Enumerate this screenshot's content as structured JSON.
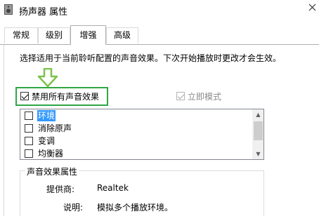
{
  "window": {
    "title": "扬声器 属性",
    "close_glyph": "X"
  },
  "tabs": [
    {
      "label": "常规",
      "active": false
    },
    {
      "label": "级别",
      "active": false
    },
    {
      "label": "增强",
      "active": true
    },
    {
      "label": "高级",
      "active": false
    }
  ],
  "enhancements": {
    "description": "选择适用于当前聆听配置的声音效果。下次开始播放时更改才会生效。",
    "disable_all": {
      "label": "禁用所有声音效果",
      "checked": true
    },
    "immediate_mode": {
      "label": "立即模式",
      "checked": true,
      "disabled": true
    },
    "effects": [
      {
        "label": "环境",
        "checked": false,
        "selected": true
      },
      {
        "label": "消除原声",
        "checked": false,
        "selected": false
      },
      {
        "label": "变调",
        "checked": false,
        "selected": false
      },
      {
        "label": "均衡器",
        "checked": false,
        "selected": false
      }
    ]
  },
  "properties": {
    "group_title": "声音效果属性",
    "provider_label": "提供商:",
    "provider_value": "Realtek",
    "description_label": "说明:",
    "description_value": "模拟多个播放环境。"
  },
  "colors": {
    "highlight_box": "#2fa745",
    "selection": "#3399ff",
    "arrow": "#7cc34a"
  },
  "icons": {
    "window": "speaker-icon",
    "close": "close-icon",
    "annotation": "arrow-down-icon"
  }
}
